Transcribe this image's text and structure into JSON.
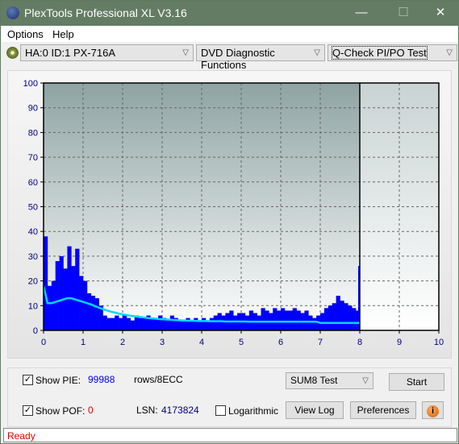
{
  "window": {
    "title": "PlexTools Professional XL V3.16",
    "logo_text": "XL"
  },
  "menu": [
    "Options",
    "Help"
  ],
  "toolbar": {
    "drive": "HA:0 ID:1  PX-716A",
    "function": "DVD Diagnostic Functions",
    "test": "Q-Check PI/PO Test"
  },
  "chart_data": {
    "type": "bar",
    "xlim": [
      0,
      10
    ],
    "ylim": [
      0,
      100
    ],
    "x_ticks": [
      "0",
      "1",
      "2",
      "3",
      "4",
      "5",
      "6",
      "7",
      "8",
      "9",
      "10"
    ],
    "y_ticks": [
      "0",
      "10",
      "20",
      "30",
      "40",
      "50",
      "60",
      "70",
      "80",
      "90",
      "100"
    ],
    "grid": true,
    "x": [
      0,
      0.1,
      0.2,
      0.3,
      0.4,
      0.5,
      0.6,
      0.7,
      0.8,
      0.9,
      1.0,
      1.1,
      1.2,
      1.3,
      1.4,
      1.5,
      1.6,
      1.7,
      1.8,
      1.9,
      2.0,
      2.1,
      2.2,
      2.3,
      2.4,
      2.5,
      2.6,
      2.7,
      2.8,
      2.9,
      3.0,
      3.1,
      3.2,
      3.3,
      3.4,
      3.5,
      3.6,
      3.7,
      3.8,
      3.9,
      4.0,
      4.1,
      4.2,
      4.3,
      4.4,
      4.5,
      4.6,
      4.7,
      4.8,
      4.9,
      5.0,
      5.1,
      5.2,
      5.3,
      5.4,
      5.5,
      5.6,
      5.7,
      5.8,
      5.9,
      6.0,
      6.1,
      6.2,
      6.3,
      6.4,
      6.5,
      6.6,
      6.7,
      6.8,
      6.9,
      7.0,
      7.1,
      7.2,
      7.3,
      7.4,
      7.5,
      7.6,
      7.7,
      7.8,
      7.9,
      8.0
    ],
    "series": [
      {
        "kind": "bar",
        "color": "#0000ff",
        "values": [
          38,
          18,
          20,
          28,
          30,
          25,
          34,
          26,
          33,
          22,
          20,
          15,
          14,
          13,
          10,
          6,
          5,
          5,
          6,
          5,
          6,
          5,
          4,
          6,
          5,
          5,
          6,
          5,
          5,
          6,
          5,
          4,
          6,
          5,
          4,
          4,
          5,
          4,
          5,
          4,
          5,
          4,
          5,
          6,
          7,
          6,
          7,
          8,
          6,
          7,
          7,
          6,
          8,
          7,
          6,
          9,
          8,
          7,
          9,
          8,
          9,
          8,
          8,
          9,
          8,
          7,
          8,
          6,
          5,
          6,
          7,
          9,
          10,
          11,
          14,
          12,
          11,
          10,
          9,
          8,
          26
        ]
      },
      {
        "kind": "line",
        "color": "#00d8ff",
        "values": [
          18,
          11,
          11,
          11.5,
          12,
          12.5,
          13,
          13,
          12.5,
          12,
          11.5,
          11,
          10.5,
          9.8,
          9.2,
          8.6,
          8.1,
          7.6,
          7.2,
          6.8,
          6.5,
          6.2,
          5.9,
          5.7,
          5.5,
          5.3,
          5.1,
          4.9,
          4.8,
          4.6,
          4.5,
          4.4,
          4.3,
          4.2,
          4.1,
          4.0,
          4.0,
          3.9,
          3.9,
          3.8,
          3.8,
          3.8,
          3.7,
          3.7,
          3.7,
          3.7,
          3.6,
          3.6,
          3.6,
          3.6,
          3.6,
          3.6,
          3.5,
          3.5,
          3.5,
          3.5,
          3.5,
          3.5,
          3.5,
          3.5,
          3.5,
          3.5,
          3.5,
          3.5,
          3.5,
          3.5,
          3.5,
          3.5,
          3.5,
          3.5,
          3.0,
          3.0,
          3.0,
          3.0,
          3.0,
          3.0,
          3.0,
          3.0,
          3.0,
          3.0,
          3.0
        ]
      }
    ],
    "marker_x": 8
  },
  "controls": {
    "show_pie_label": "Show PIE:",
    "pie_value": "99988",
    "rows_label": "rows/8ECC",
    "show_pof_label": "Show POF:",
    "pof_value": "0",
    "lsn_label": "LSN:",
    "lsn_value": "4173824",
    "logarithmic_label": "Logarithmic",
    "mode": "SUM8 Test",
    "start": "Start",
    "view_log": "View Log",
    "preferences": "Preferences",
    "show_pie": true,
    "show_pof": true,
    "logarithmic": false
  },
  "status": "Ready"
}
